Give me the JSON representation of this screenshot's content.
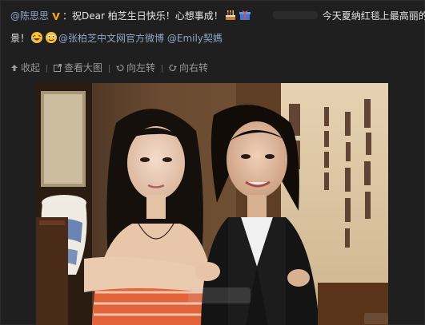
{
  "post": {
    "author": "@陈思思",
    "text_line1_part1": "：祝Dear 柏芝生日快乐！心想事成！",
    "text_line1_part2": "今天夏纳红毯上最高丽的风",
    "text_line2_part1": "景！",
    "mention1": "@张柏芝中文网官方微博",
    "mention2": "@Emily契媽"
  },
  "actions": {
    "collapse": "收起",
    "view_large": "查看大图",
    "rotate_left": "向左转",
    "rotate_right": "向右转"
  },
  "icons": {
    "verified": "v-badge-icon",
    "cake": "birthday-cake-icon",
    "gift": "gift-box-icon",
    "emoji_a": "laughing-emoji-icon",
    "emoji_b": "happy-emoji-icon"
  },
  "colors": {
    "background": "#1f1f1f",
    "link": "#8fa6c6",
    "text": "#e6e6e6",
    "action_text": "#9a9a9a"
  }
}
